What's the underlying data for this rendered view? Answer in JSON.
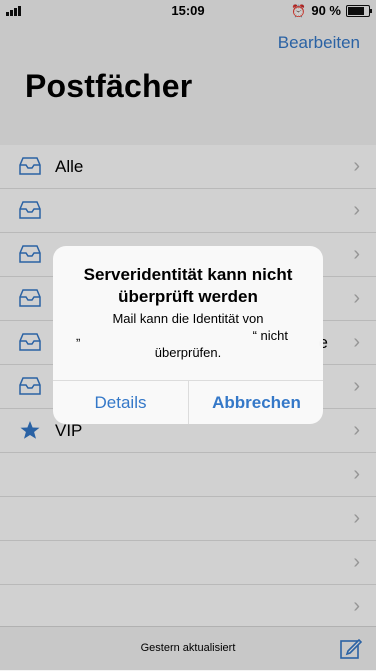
{
  "status_bar": {
    "time": "15:09",
    "battery": "90 %",
    "battery_level": 0.9
  },
  "nav": {
    "edit_label": "Bearbeiten"
  },
  "page_title": "Postfächer",
  "mailboxes": [
    {
      "icon": "inbox-tray-icon",
      "label": "Alle",
      "trailing": ""
    },
    {
      "icon": "inbox-tray-icon",
      "label": "",
      "trailing": ""
    },
    {
      "icon": "inbox-tray-icon",
      "label": "",
      "trailing": ""
    },
    {
      "icon": "inbox-tray-icon",
      "label": "",
      "trailing": ""
    },
    {
      "icon": "inbox-tray-icon",
      "label": "",
      "trailing": "e"
    },
    {
      "icon": "inbox-tray-icon",
      "label": "",
      "trailing": ""
    },
    {
      "icon": "star-icon",
      "label": "VIP",
      "trailing": ""
    },
    {
      "icon": "",
      "label": "",
      "trailing": ""
    },
    {
      "icon": "",
      "label": "",
      "trailing": ""
    },
    {
      "icon": "",
      "label": "",
      "trailing": ""
    },
    {
      "icon": "",
      "label": "",
      "trailing": ""
    }
  ],
  "alert": {
    "title": "Serveridentität kann nicht überprüft werden",
    "message_line1": "Mail kann die Identität von",
    "message_open_quote": "„",
    "message_close_quote": "“ nicht",
    "message_line3": "überprüfen.",
    "details_label": "Details",
    "cancel_label": "Abbrechen"
  },
  "bottom_bar": {
    "status": "Gestern aktualisiert"
  },
  "colors": {
    "accent": "#3478c8"
  }
}
